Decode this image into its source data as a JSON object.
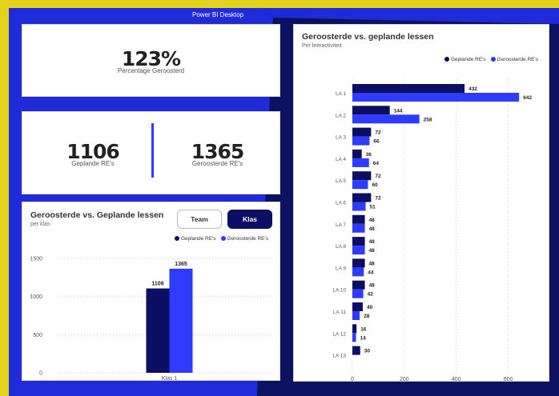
{
  "app": {
    "title": "Power BI Desktop"
  },
  "colors": {
    "planned": "#0b0e63",
    "scheduled": "#2f3bfa",
    "background": "#0c1160",
    "frame": "#e3d31a",
    "accent_shape": "#1f2bd8"
  },
  "kpi_percentage": {
    "value": "123%",
    "label": "Percentage Geroosterd"
  },
  "kpi_planned": {
    "value": "1106",
    "label": "Geplande RE's"
  },
  "kpi_scheduled": {
    "value": "1365",
    "label": "Geroosterde RE's"
  },
  "class_chart": {
    "title": "Geroosterde vs. Geplande lessen",
    "subtitle": "per klas",
    "toggle": {
      "team": "Team",
      "klas": "Klas",
      "active": "klas"
    },
    "legend": {
      "planned": "Geplande RE's",
      "scheduled": "Geroosterde RE's"
    }
  },
  "activity_chart": {
    "title": "Geroosterde vs. geplande lessen",
    "subtitle": "Per leeractiviteit",
    "legend": {
      "planned": "Geplande RE's",
      "scheduled": "Geroosterde RE's"
    }
  },
  "chart_data": [
    {
      "type": "bar",
      "title": "Geroosterde vs. Geplande lessen",
      "subtitle": "per klas",
      "categories": [
        "Klas 1"
      ],
      "series": [
        {
          "name": "Geplande RE's",
          "values": [
            1106
          ]
        },
        {
          "name": "Geroosterde RE's",
          "values": [
            1365
          ]
        }
      ],
      "ylim": [
        0,
        1500
      ],
      "yticks": [
        0,
        500,
        1000,
        1500
      ],
      "grid": true,
      "legend": "top-right"
    },
    {
      "type": "bar",
      "orientation": "horizontal",
      "title": "Geroosterde vs. geplande lessen",
      "subtitle": "Per leeractiviteit",
      "categories": [
        "LA 1",
        "LA 2",
        "LA 3",
        "LA 4",
        "LA 5",
        "LA 6",
        "LA 7",
        "LA 8",
        "LA 9",
        "LA 10",
        "LA 11",
        "LA 12",
        "LA 13"
      ],
      "series": [
        {
          "name": "Geplande RE's",
          "values": [
            432,
            144,
            72,
            36,
            72,
            72,
            48,
            48,
            48,
            48,
            40,
            16,
            30
          ]
        },
        {
          "name": "Geroosterde RE's",
          "values": [
            642,
            258,
            66,
            64,
            60,
            51,
            48,
            48,
            44,
            42,
            28,
            14,
            null
          ]
        }
      ],
      "xlim": [
        0,
        700
      ],
      "xticks": [
        0,
        200,
        400,
        600
      ],
      "grid": true,
      "legend": "top-right"
    }
  ]
}
